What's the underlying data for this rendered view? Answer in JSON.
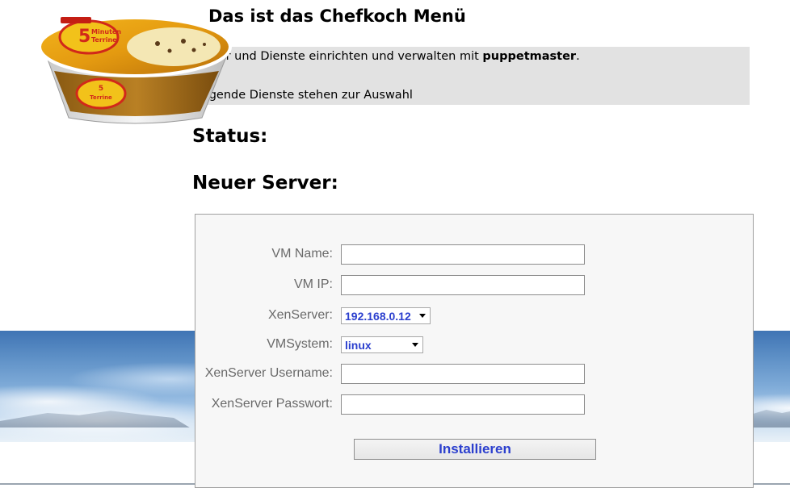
{
  "header": {
    "title": "Das ist das Chefkoch Menü"
  },
  "intro": {
    "line1_prefix": "Server und Dienste einrichten und verwalten mit ",
    "line1_bold": "puppetmaster",
    "line1_suffix": ".",
    "line2": "Folgende Dienste stehen zur Auswahl"
  },
  "sections": {
    "status_heading": "Status:",
    "new_server_heading": "Neuer Server:"
  },
  "form": {
    "vm_name": {
      "label": "VM Name:",
      "value": ""
    },
    "vm_ip": {
      "label": "VM IP:",
      "value": ""
    },
    "xenserver": {
      "label": "XenServer:",
      "selected": "192.168.0.12"
    },
    "vmsystem": {
      "label": "VMSystem:",
      "selected": "linux"
    },
    "xen_username": {
      "label": "XenServer Username:",
      "value": ""
    },
    "xen_password": {
      "label": "XenServer Passwort:",
      "value": ""
    },
    "submit_label": "Installieren"
  },
  "product_image": {
    "icon": "soup-cup-image"
  },
  "colors": {
    "link_blue": "#2b3fce",
    "intro_bg": "#e2e2e2",
    "panel_bg": "#f7f7f7",
    "label_gray": "#6a6a6a"
  }
}
